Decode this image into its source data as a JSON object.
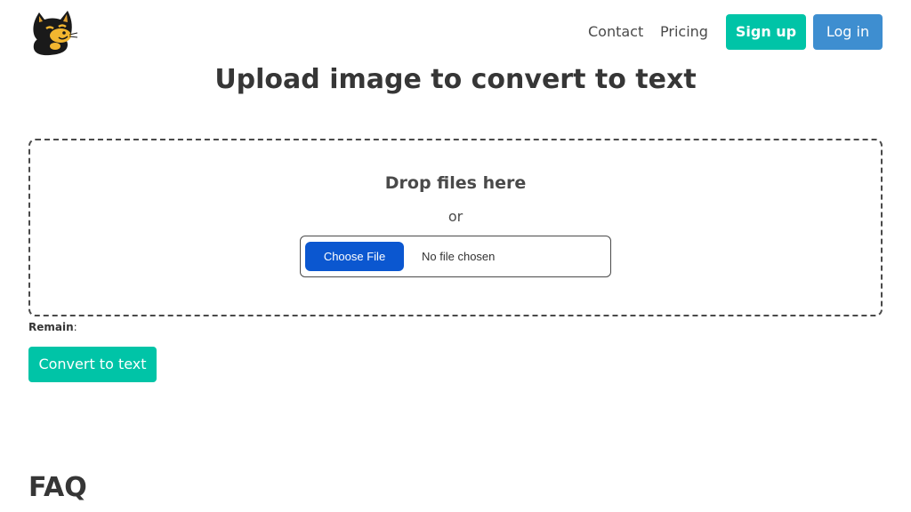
{
  "header": {
    "logo_icon": "cat-logo-icon",
    "nav": {
      "contact": "Contact",
      "pricing": "Pricing"
    },
    "signup_label": "Sign up",
    "login_label": "Log in"
  },
  "main": {
    "title": "Upload image to convert to text",
    "dropzone": {
      "title": "Drop files here",
      "or": "or",
      "choose_file_label": "Choose File",
      "no_file_text": "No file chosen"
    },
    "remain": {
      "label": "Remain",
      "separator": ":"
    },
    "convert_label": "Convert to text"
  },
  "faq": {
    "title": "FAQ"
  },
  "colors": {
    "primary": "#00c4a7",
    "info": "#3e8ed0",
    "file_button": "#0b57d0",
    "text": "#363636"
  }
}
